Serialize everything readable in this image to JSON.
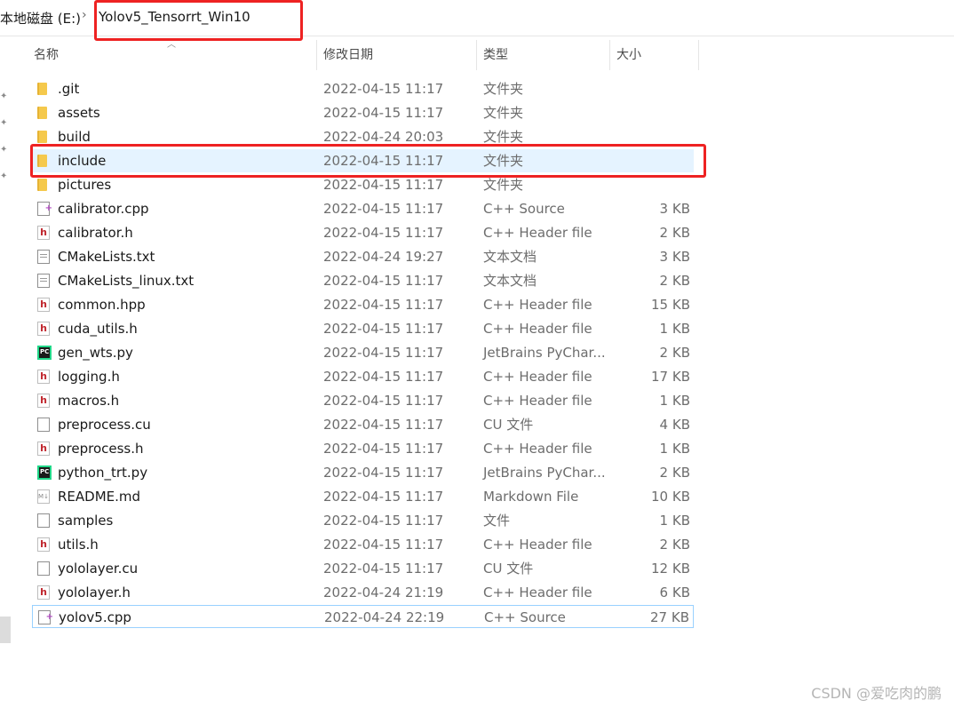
{
  "address_bar": {
    "root": "本地磁盘 (E:)",
    "separator": "›",
    "current_folder": "Yolov5_Tensorrt_Win10"
  },
  "columns": {
    "name": "名称",
    "date_modified": "修改日期",
    "type": "类型",
    "size": "大小"
  },
  "files": [
    {
      "name": ".git",
      "date": "2022-04-15 11:17",
      "type": "文件夹",
      "size": "",
      "icon": "folder-icon"
    },
    {
      "name": "assets",
      "date": "2022-04-15 11:17",
      "type": "文件夹",
      "size": "",
      "icon": "folder-icon"
    },
    {
      "name": "build",
      "date": "2022-04-24 20:03",
      "type": "文件夹",
      "size": "",
      "icon": "folder-icon"
    },
    {
      "name": "include",
      "date": "2022-04-15 11:17",
      "type": "文件夹",
      "size": "",
      "icon": "folder-icon",
      "selected": true
    },
    {
      "name": "pictures",
      "date": "2022-04-15 11:17",
      "type": "文件夹",
      "size": "",
      "icon": "folder-icon"
    },
    {
      "name": "calibrator.cpp",
      "date": "2022-04-15 11:17",
      "type": "C++ Source",
      "size": "3 KB",
      "icon": "cpp-file-icon"
    },
    {
      "name": "calibrator.h",
      "date": "2022-04-15 11:17",
      "type": "C++ Header file",
      "size": "2 KB",
      "icon": "header-file-icon"
    },
    {
      "name": "CMakeLists.txt",
      "date": "2022-04-24 19:27",
      "type": "文本文档",
      "size": "3 KB",
      "icon": "text-file-icon"
    },
    {
      "name": "CMakeLists_linux.txt",
      "date": "2022-04-15 11:17",
      "type": "文本文档",
      "size": "2 KB",
      "icon": "text-file-icon"
    },
    {
      "name": "common.hpp",
      "date": "2022-04-15 11:17",
      "type": "C++ Header file",
      "size": "15 KB",
      "icon": "header-file-icon"
    },
    {
      "name": "cuda_utils.h",
      "date": "2022-04-15 11:17",
      "type": "C++ Header file",
      "size": "1 KB",
      "icon": "header-file-icon"
    },
    {
      "name": "gen_wts.py",
      "date": "2022-04-15 11:17",
      "type": "JetBrains PyChar...",
      "size": "2 KB",
      "icon": "pycharm-file-icon"
    },
    {
      "name": "logging.h",
      "date": "2022-04-15 11:17",
      "type": "C++ Header file",
      "size": "17 KB",
      "icon": "header-file-icon"
    },
    {
      "name": "macros.h",
      "date": "2022-04-15 11:17",
      "type": "C++ Header file",
      "size": "1 KB",
      "icon": "header-file-icon"
    },
    {
      "name": "preprocess.cu",
      "date": "2022-04-15 11:17",
      "type": "CU 文件",
      "size": "4 KB",
      "icon": "blank-file-icon"
    },
    {
      "name": "preprocess.h",
      "date": "2022-04-15 11:17",
      "type": "C++ Header file",
      "size": "1 KB",
      "icon": "header-file-icon"
    },
    {
      "name": "python_trt.py",
      "date": "2022-04-15 11:17",
      "type": "JetBrains PyChar...",
      "size": "2 KB",
      "icon": "pycharm-file-icon"
    },
    {
      "name": "README.md",
      "date": "2022-04-15 11:17",
      "type": "Markdown File",
      "size": "10 KB",
      "icon": "markdown-file-icon"
    },
    {
      "name": "samples",
      "date": "2022-04-15 11:17",
      "type": "文件",
      "size": "1 KB",
      "icon": "blank-file-icon"
    },
    {
      "name": "utils.h",
      "date": "2022-04-15 11:17",
      "type": "C++ Header file",
      "size": "2 KB",
      "icon": "header-file-icon"
    },
    {
      "name": "yololayer.cu",
      "date": "2022-04-15 11:17",
      "type": "CU 文件",
      "size": "12 KB",
      "icon": "blank-file-icon"
    },
    {
      "name": "yololayer.h",
      "date": "2022-04-24 21:19",
      "type": "C++ Header file",
      "size": "6 KB",
      "icon": "header-file-icon"
    },
    {
      "name": "yolov5.cpp",
      "date": "2022-04-24 22:19",
      "type": "C++ Source",
      "size": "27 KB",
      "icon": "cpp-file-icon",
      "focused": true
    }
  ],
  "watermark": "CSDN @爱吃肉的鹏",
  "colors": {
    "highlight_box": "#ee2222",
    "selection_bg": "#e5f3ff",
    "folder": "#f5c94c",
    "header_icon": "#c0262d"
  }
}
